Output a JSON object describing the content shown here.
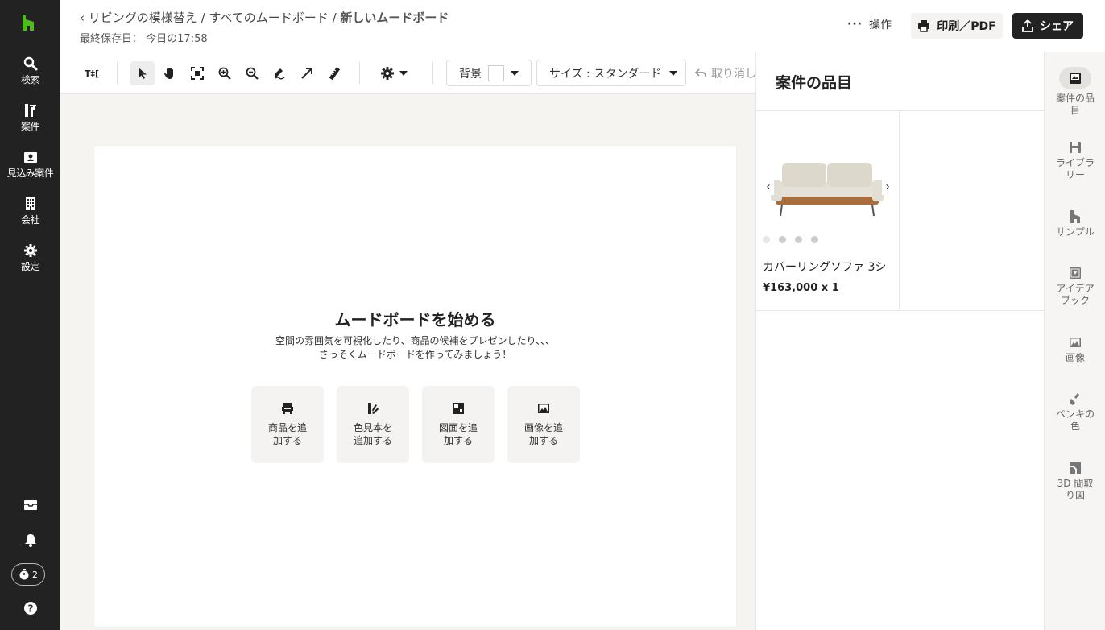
{
  "leftnav": {
    "items": [
      {
        "label": "検索",
        "icon": "search-icon"
      },
      {
        "label": "案件",
        "icon": "projects-icon"
      },
      {
        "label": "見込み案件",
        "icon": "leads-icon"
      },
      {
        "label": "会社",
        "icon": "company-icon"
      },
      {
        "label": "設定",
        "icon": "gear-icon"
      }
    ],
    "timer_count": "2"
  },
  "header": {
    "breadcrumb_1": "リビングの模様替え",
    "separator": "/",
    "breadcrumb_2": "すべてのムードボード",
    "breadcrumb_current": "新しいムードボード",
    "saved_label": "最終保存日：",
    "saved_value": "今日の17:58",
    "ops_label": "操作",
    "print_label": "印刷／PDF",
    "share_label": "シェア"
  },
  "toolbar": {
    "text_tool": "T‡[",
    "background_label": "背景",
    "background_color": "#ffffff",
    "size_label": "サイズ : スタンダード",
    "undo_label": "取り消し"
  },
  "canvas": {
    "title": "ムードボードを始める",
    "desc_line1": "空間の雰囲気を可視化したり、商品の候補をプレゼンしたり、、、",
    "desc_line2": "さっそくムードボードを作ってみましょう！",
    "cards": [
      {
        "label": "商品を追加する",
        "icon": "chair-icon"
      },
      {
        "label": "色見本を追加する",
        "icon": "swatch-icon"
      },
      {
        "label": "図面を追加する",
        "icon": "floorplan-icon"
      },
      {
        "label": "画像を追加する",
        "icon": "image-icon"
      }
    ]
  },
  "panel": {
    "title": "案件の品目",
    "product": {
      "name": "カバーリングソファ 3シ",
      "price": "¥163,000 x 1",
      "image_dots": 4
    }
  },
  "rail": {
    "items": [
      {
        "label": "案件の品目",
        "icon": "project-items-icon",
        "active": true
      },
      {
        "label": "ライブラリー",
        "icon": "library-icon"
      },
      {
        "label": "サンプル",
        "icon": "sample-icon"
      },
      {
        "label": "アイデアブック",
        "icon": "ideabook-icon"
      },
      {
        "label": "画像",
        "icon": "image-icon"
      },
      {
        "label": "ペンキの色",
        "icon": "paint-brush-icon"
      },
      {
        "label": "3D 間取り図",
        "icon": "3d-floorplan-icon"
      }
    ]
  },
  "colors": {
    "nav_bg": "#222222",
    "brand_green": "#4dbc15",
    "canvas_bg": "#f6f4f1"
  }
}
